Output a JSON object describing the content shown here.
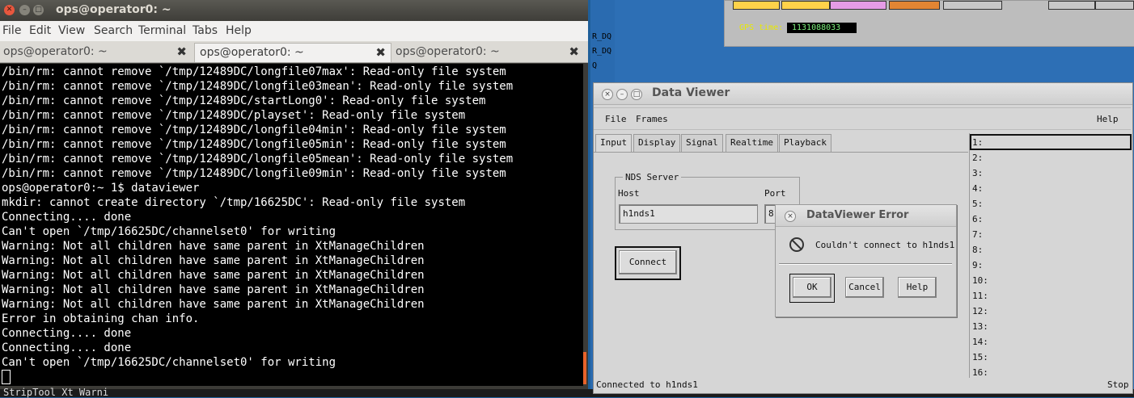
{
  "terminal": {
    "window_title": "ops@operator0: ~",
    "menu": [
      "File",
      "Edit",
      "View",
      "Search",
      "Terminal",
      "Tabs",
      "Help"
    ],
    "tabs": [
      {
        "label": "ops@operator0: ~",
        "active": false
      },
      {
        "label": "ops@operator0: ~",
        "active": true
      },
      {
        "label": "ops@operator0: ~",
        "active": false
      }
    ],
    "lines": [
      "/bin/rm: cannot remove `/tmp/12489DC/longfile07max': Read-only file system",
      "/bin/rm: cannot remove `/tmp/12489DC/longfile03mean': Read-only file system",
      "/bin/rm: cannot remove `/tmp/12489DC/startLong0': Read-only file system",
      "/bin/rm: cannot remove `/tmp/12489DC/playset': Read-only file system",
      "/bin/rm: cannot remove `/tmp/12489DC/longfile04min': Read-only file system",
      "/bin/rm: cannot remove `/tmp/12489DC/longfile05min': Read-only file system",
      "/bin/rm: cannot remove `/tmp/12489DC/longfile05mean': Read-only file system",
      "/bin/rm: cannot remove `/tmp/12489DC/longfile09min': Read-only file system",
      "ops@operator0:~ 1$ dataviewer",
      "mkdir: cannot create directory `/tmp/16625DC': Read-only file system",
      "Connecting.... done",
      "Can't open `/tmp/16625DC/channelset0' for writing",
      "Warning: Not all children have same parent in XtManageChildren",
      "Warning: Not all children have same parent in XtManageChildren",
      "Warning: Not all children have same parent in XtManageChildren",
      "Warning: Not all children have same parent in XtManageChildren",
      "Warning: Not all children have same parent in XtManageChildren",
      "Error in obtaining chan info.",
      "Connecting.... done",
      "Connecting.... done",
      "Can't open `/tmp/16625DC/channelset0' for writing"
    ]
  },
  "background": {
    "gps_label": "GPS time:",
    "gps_value": "1131088033",
    "side_labels": [
      "R_DQ",
      "R_DQ",
      "Q"
    ],
    "bottom_text": "StripTool Xt Warni"
  },
  "dataviewer": {
    "title": "Data Viewer",
    "menu": {
      "file": "File",
      "frames": "Frames",
      "help": "Help"
    },
    "tabs": [
      "Input",
      "Display",
      "Signal",
      "Realtime",
      "Playback"
    ],
    "nds_frame_label": "NDS Server",
    "host_label": "Host",
    "port_label": "Port",
    "host_value": "h1nds1",
    "port_value": "8",
    "connect_label": "Connect",
    "status": "Connected to h1nds1",
    "stop_label": "Stop",
    "slots": [
      "1:",
      "2:",
      "3:",
      "4:",
      "5:",
      "6:",
      "7:",
      "8:",
      "9:",
      "10:",
      "11:",
      "12:",
      "13:",
      "14:",
      "15:",
      "16:"
    ]
  },
  "error_dialog": {
    "title": "DataViewer Error",
    "message": "Couldn't connect to h1nds1",
    "ok": "OK",
    "cancel": "Cancel",
    "help": "Help",
    "icon": "error-icon"
  },
  "colors": {
    "terminal_bg": "#000000",
    "terminal_fg": "#ffffff",
    "ubuntu_close": "#e8573e",
    "gps_value_text": "#7cf07c"
  }
}
